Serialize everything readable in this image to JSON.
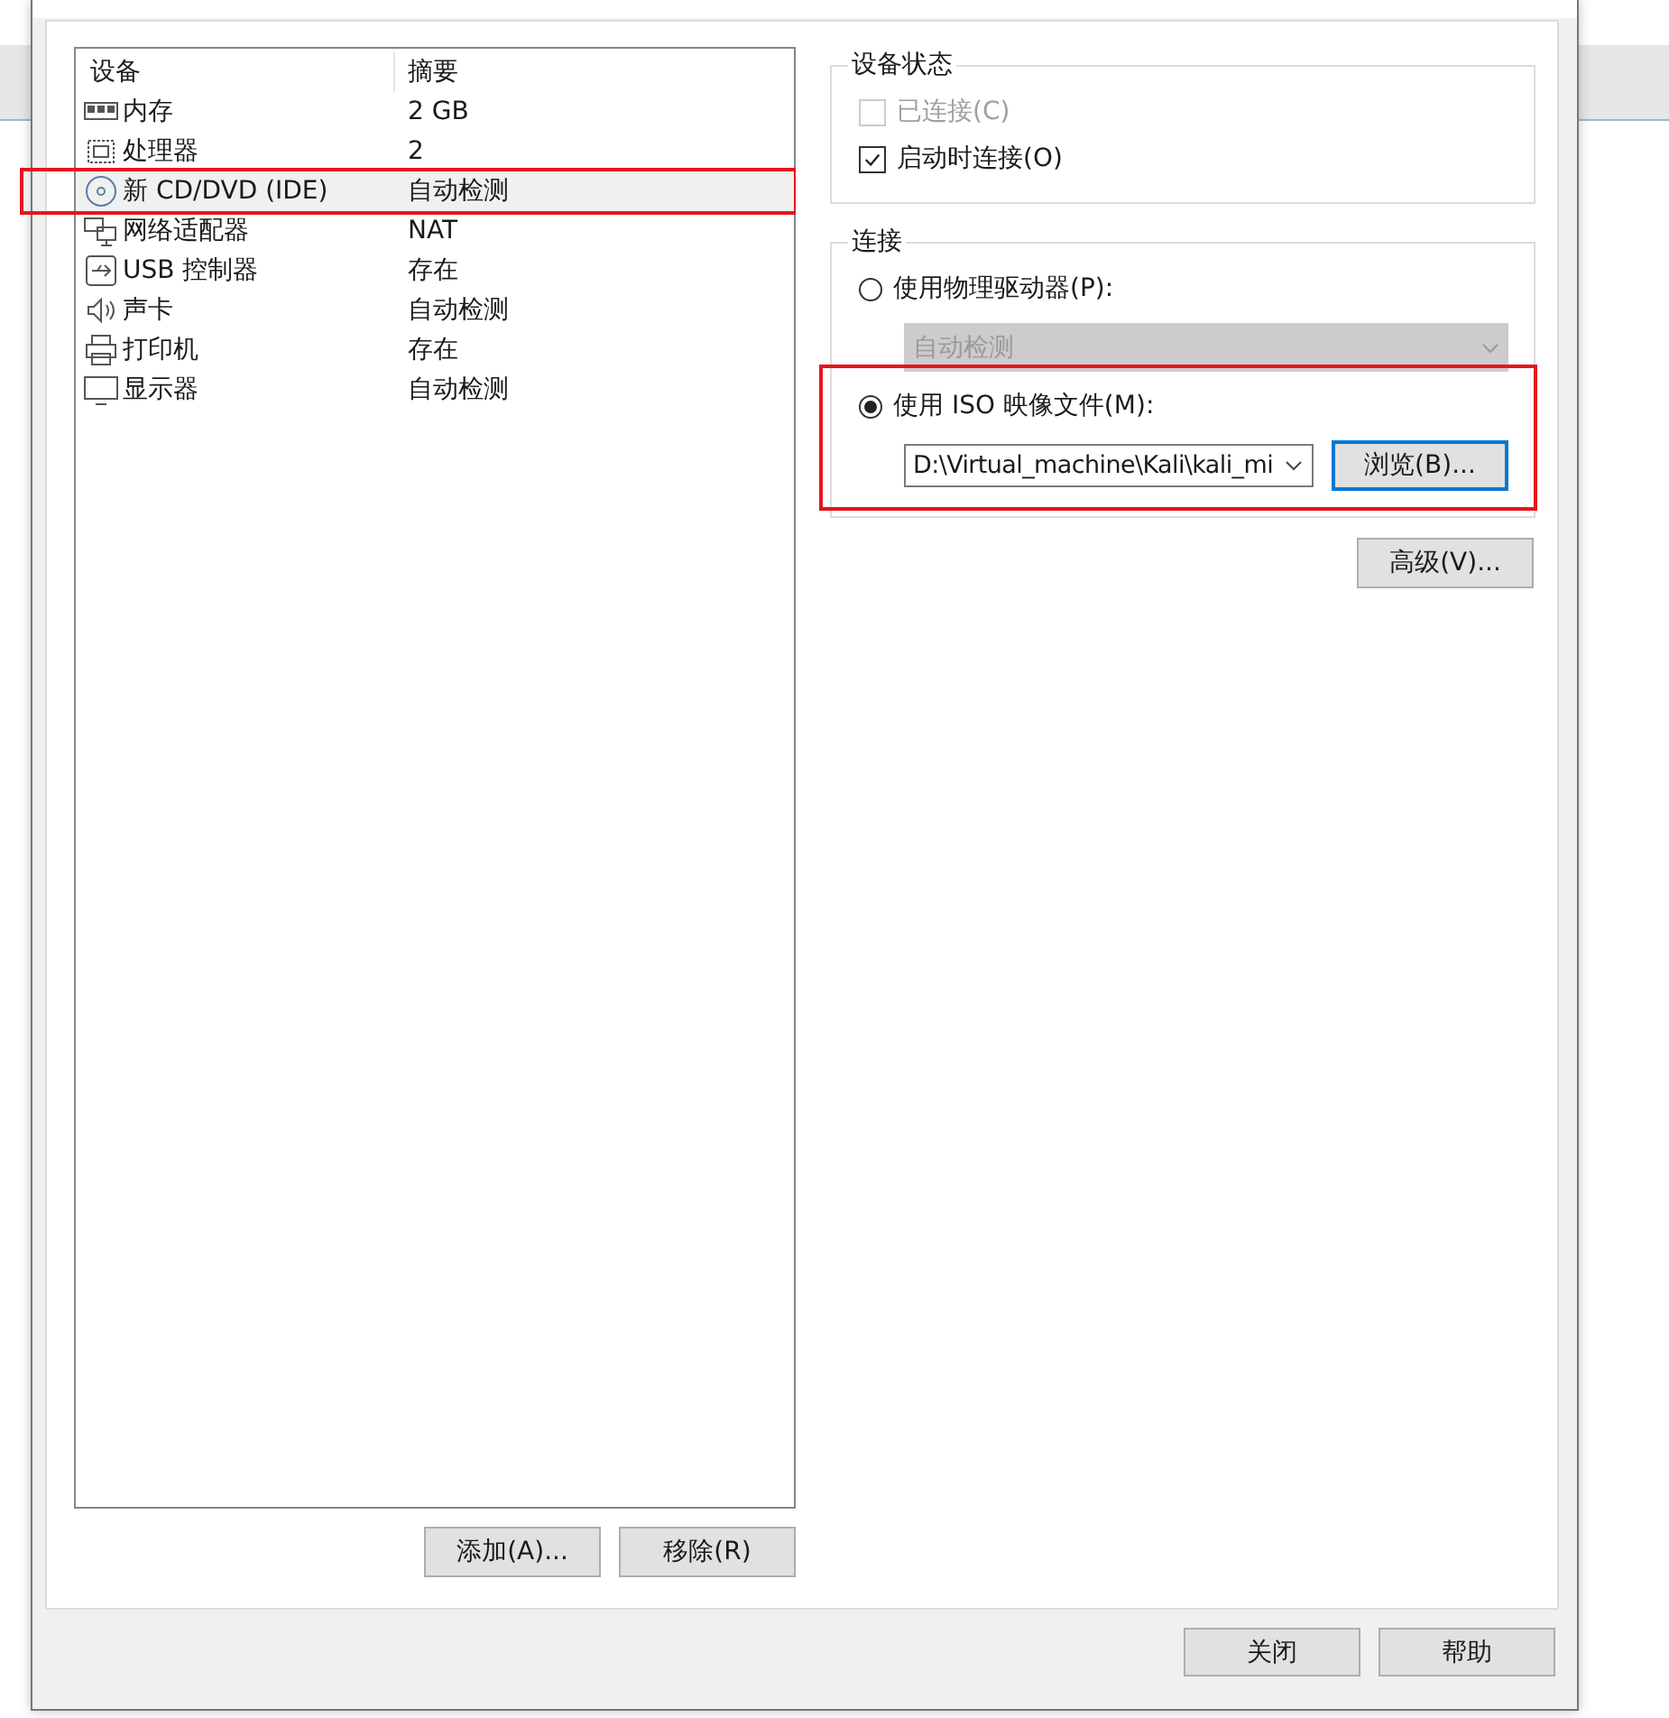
{
  "device_list": {
    "columns": [
      "设备",
      "摘要"
    ],
    "rows": [
      {
        "kind": "memory",
        "name": "内存",
        "summary": "2 GB",
        "selected": false,
        "annotated": false
      },
      {
        "kind": "cpu",
        "name": "处理器",
        "summary": "2",
        "selected": false,
        "annotated": false
      },
      {
        "kind": "disc",
        "name": "新 CD/DVD (IDE)",
        "summary": "自动检测",
        "selected": true,
        "annotated": true
      },
      {
        "kind": "network",
        "name": "网络适配器",
        "summary": "NAT",
        "selected": false,
        "annotated": false
      },
      {
        "kind": "usb",
        "name": "USB 控制器",
        "summary": "存在",
        "selected": false,
        "annotated": false
      },
      {
        "kind": "sound",
        "name": "声卡",
        "summary": "自动检测",
        "selected": false,
        "annotated": false
      },
      {
        "kind": "printer",
        "name": "打印机",
        "summary": "存在",
        "selected": false,
        "annotated": false
      },
      {
        "kind": "monitor",
        "name": "显示器",
        "summary": "自动检测",
        "selected": false,
        "annotated": false
      }
    ],
    "buttons": [
      "添加(A)...",
      "移除(R)"
    ]
  },
  "device_status": {
    "title": "设备状态",
    "options": [
      {
        "label": "已连接(C)",
        "checked": false,
        "disabled": true
      },
      {
        "label": "启动时连接(O)",
        "checked": true,
        "disabled": false
      }
    ]
  },
  "connection": {
    "title": "连接",
    "physical": {
      "label": "使用物理驱动器(P):",
      "selected": false,
      "drive": {
        "value": "自动检测",
        "disabled": true
      }
    },
    "iso": {
      "label": "使用 ISO 映像文件(M):",
      "selected": true,
      "annotated": true,
      "path": "D:\\Virtual_machine\\Kali\\kali_mi",
      "browse": "浏览(B)..."
    }
  },
  "advanced_button": "高级(V)...",
  "footer_buttons": [
    "关闭",
    "帮助"
  ]
}
